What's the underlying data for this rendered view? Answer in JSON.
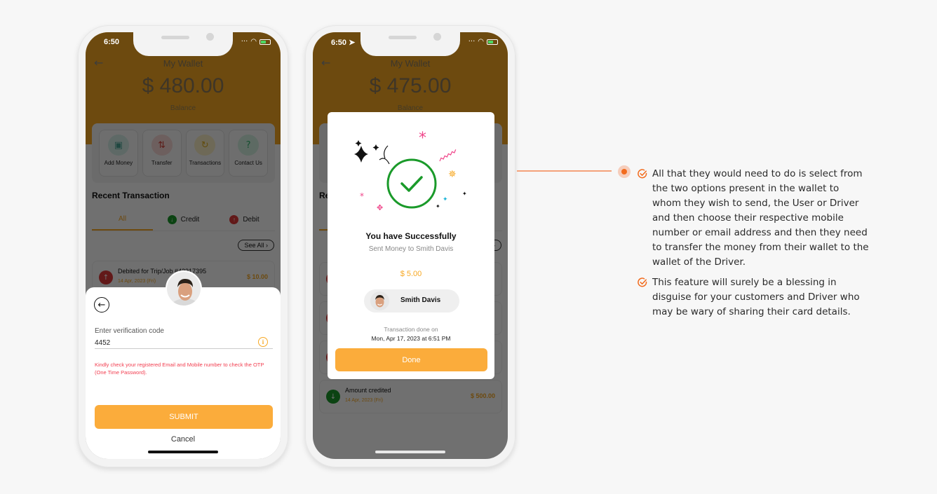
{
  "phone1": {
    "status_time": "6:50",
    "header": {
      "title": "My Wallet",
      "balance": "$ 480.00",
      "balance_label": "Balance"
    },
    "actions": [
      {
        "label": "Add Money",
        "icon": "folder-plus-icon",
        "color": "#5fb8a8"
      },
      {
        "label": "Transfer",
        "icon": "transfer-icon",
        "color": "#e0564e"
      },
      {
        "label": "Transactions",
        "icon": "sync-icon",
        "color": "#f2c230"
      },
      {
        "label": "Contact Us",
        "icon": "help-icon",
        "color": "#3cc07a"
      }
    ],
    "recent_title": "Recent Transaction",
    "tabs": [
      {
        "label": "All",
        "active": true
      },
      {
        "label": "Credit",
        "icon": "arrow-down-icon",
        "color": "#1a9a2a"
      },
      {
        "label": "Debit",
        "icon": "arrow-up-icon",
        "color": "#e03a3a"
      }
    ],
    "see_all": "See All",
    "transactions": [
      {
        "title": "Debited for Trip/Job #43317395",
        "date": "14 Apr, 2023 (Fri)",
        "amount": "$ 10.00",
        "type": "debit"
      }
    ],
    "sheet": {
      "code_label": "Enter verification code",
      "code_value": "4452",
      "warning": "Kindly check your registered Email and Mobile number to check the OTP (One Time Password).",
      "submit_label": "SUBMIT",
      "cancel_label": "Cancel"
    }
  },
  "phone2": {
    "status_time": "6:50",
    "header": {
      "title": "My Wallet",
      "balance": "$ 475.00",
      "balance_label": "Balance"
    },
    "recent_title": "Re",
    "transactions": [
      {
        "title": "Amount credited",
        "date": "14 Apr, 2023 (Fri)",
        "amount": "$ 500.00",
        "type": "credit"
      }
    ],
    "modal": {
      "title": "You have Successfully",
      "subtitle": "Sent Money to Smith Davis",
      "amount": "$ 5.00",
      "recipient_name": "Smith Davis",
      "done_on_label": "Transaction done on",
      "done_on_date": "Mon, Apr 17, 2023 at 6:51 PM",
      "done_button": "Done"
    }
  },
  "annotation": {
    "bullets": [
      "All that they would need to do is select from the two options present in the wallet to whom they wish to send, the User or Driver and then choose their respective mobile number or email address and then they need to transfer the money from their wallet to the wallet of the Driver.",
      "This feature will surely be a blessing in disguise for your customers and Driver who may be wary of sharing their card details."
    ]
  },
  "colors": {
    "accent": "#f7a823",
    "button": "#fbac3b",
    "success": "#1a9a2a",
    "error": "#f23d4f",
    "annotation": "#f26b1d"
  }
}
